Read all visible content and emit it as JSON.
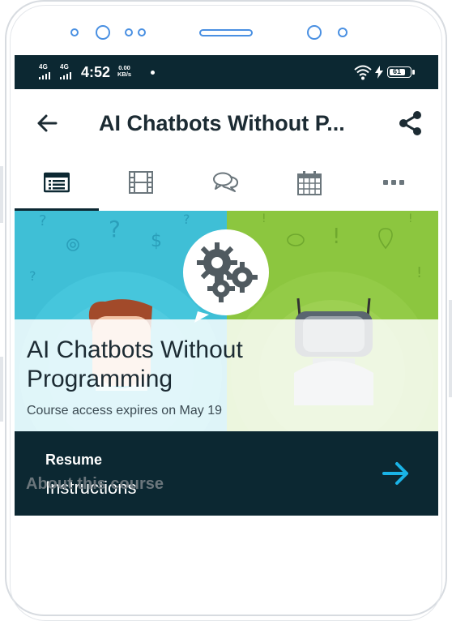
{
  "status_bar": {
    "network_1": "4G",
    "network_2": "4G",
    "time": "4:52",
    "speed_value": "0.00",
    "speed_unit": "KB/s",
    "battery": "61"
  },
  "header": {
    "title": "AI Chatbots Without P..."
  },
  "tabs": [
    {
      "name": "overview",
      "icon": "course-outline-icon",
      "selected": true
    },
    {
      "name": "videos",
      "icon": "film-icon",
      "selected": false
    },
    {
      "name": "discussions",
      "icon": "chat-bubbles-icon",
      "selected": false
    },
    {
      "name": "dates",
      "icon": "calendar-icon",
      "selected": false
    },
    {
      "name": "more",
      "icon": "more-dots-icon",
      "selected": false
    }
  ],
  "hero": {
    "course_title_line1": "AI Chatbots Without",
    "course_title_line2": "Programming",
    "expiry": "Course access expires on May 19",
    "left_color": "#3fbfd6",
    "right_color": "#8cc63f"
  },
  "resume": {
    "label": "Resume",
    "subtitle": "Instructions",
    "arrow_color": "#1ab3e6"
  },
  "about": {
    "heading": "About this course"
  },
  "colors": {
    "dark_navy": "#0c2832",
    "title_text": "#1c2b33"
  }
}
